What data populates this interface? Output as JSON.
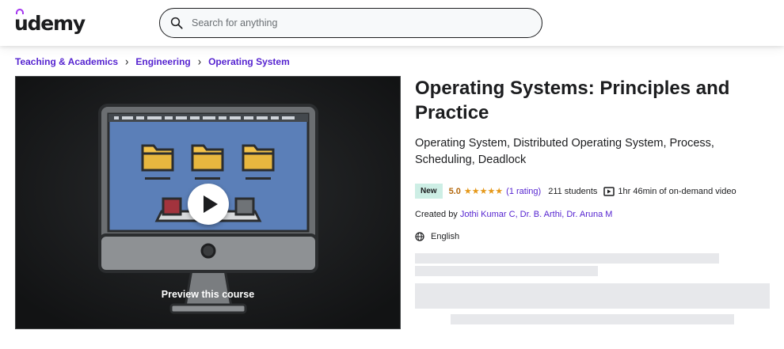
{
  "brand": {
    "logo_text": "udemy",
    "accent": "#a435f0",
    "link_color": "#5624d0"
  },
  "search": {
    "placeholder": "Search for anything",
    "icon": "search-icon"
  },
  "breadcrumb": {
    "items": [
      "Teaching & Academics",
      "Engineering",
      "Operating System"
    ],
    "separator": "›"
  },
  "preview": {
    "label": "Preview this course",
    "icon": "play-icon"
  },
  "course": {
    "title": "Operating Systems: Principles and Practice",
    "subtitle": "Operating System, Distributed Operating System, Process, Scheduling, Deadlock",
    "badge": "New",
    "rating": "5.0",
    "stars": "★★★★★",
    "rating_count": "(1 rating)",
    "students": "211 students",
    "video_length": "1hr 46min of on-demand video",
    "created_by_label": "Created by",
    "instructors": "Jothi Kumar C, Dr. B. Arthi, Dr. Aruna M",
    "language": "English"
  }
}
